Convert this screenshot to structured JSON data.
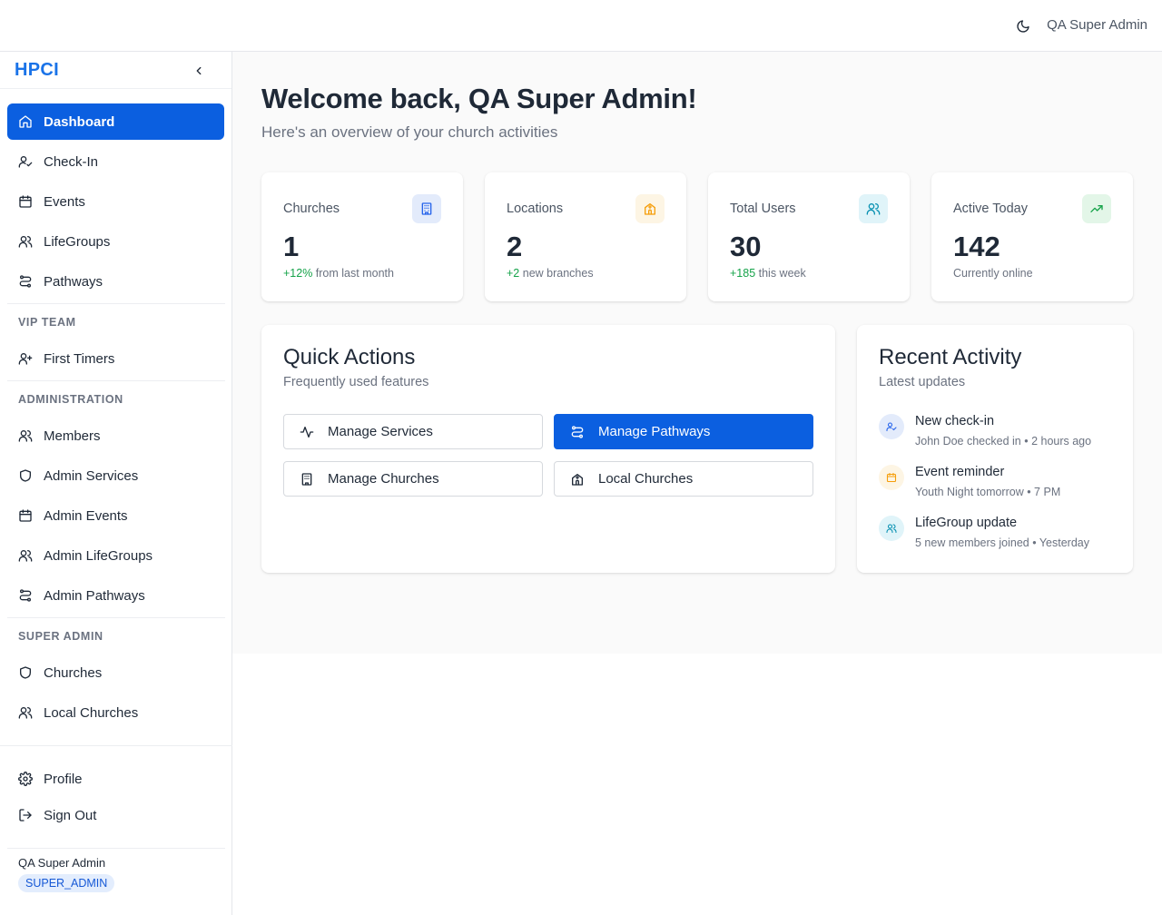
{
  "header": {
    "user_name": "QA Super Admin",
    "theme_icon": "moon-icon"
  },
  "sidebar": {
    "brand": "HPCI",
    "primary_items": [
      {
        "label": "Dashboard",
        "icon": "home-icon",
        "active": true
      },
      {
        "label": "Check-In",
        "icon": "user-check-icon"
      },
      {
        "label": "Events",
        "icon": "calendar-icon"
      },
      {
        "label": "LifeGroups",
        "icon": "users-icon"
      },
      {
        "label": "Pathways",
        "icon": "route-icon"
      }
    ],
    "sections": [
      {
        "label": "VIP TEAM",
        "items": [
          {
            "label": "First Timers",
            "icon": "user-plus-icon"
          }
        ]
      },
      {
        "label": "ADMINISTRATION",
        "items": [
          {
            "label": "Members",
            "icon": "users-icon"
          },
          {
            "label": "Admin Services",
            "icon": "shield-icon"
          },
          {
            "label": "Admin Events",
            "icon": "calendar-icon"
          },
          {
            "label": "Admin LifeGroups",
            "icon": "users-icon"
          },
          {
            "label": "Admin Pathways",
            "icon": "route-icon"
          }
        ]
      },
      {
        "label": "SUPER ADMIN",
        "items": [
          {
            "label": "Churches",
            "icon": "shield-icon"
          },
          {
            "label": "Local Churches",
            "icon": "users-icon"
          }
        ]
      }
    ],
    "footer_items": [
      {
        "label": "Profile",
        "icon": "gear-icon"
      },
      {
        "label": "Sign Out",
        "icon": "logout-icon"
      }
    ],
    "user": {
      "name": "QA Super Admin",
      "role": "SUPER_ADMIN"
    }
  },
  "main": {
    "welcome": "Welcome back, QA Super Admin!",
    "subtitle": "Here's an overview of your church activities",
    "stats": [
      {
        "label": "Churches",
        "value": "1",
        "delta": "+12%",
        "foot": " from last month",
        "icon": "building-icon",
        "accent": "#2563eb",
        "bg": "#e3ebfb"
      },
      {
        "label": "Locations",
        "value": "2",
        "delta": "+2",
        "foot": " new branches",
        "icon": "church-icon",
        "accent": "#f59e0b",
        "bg": "#fdf5e4"
      },
      {
        "label": "Total Users",
        "value": "30",
        "delta": "+185",
        "foot": " this week",
        "icon": "users-icon",
        "accent": "#0891b2",
        "bg": "#e0f4f9"
      },
      {
        "label": "Active Today",
        "value": "142",
        "delta": "",
        "foot": "Currently online",
        "icon": "trending-up-icon",
        "accent": "#16a34a",
        "bg": "#e3f6e8"
      }
    ],
    "quick_actions": {
      "title": "Quick Actions",
      "subtitle": "Frequently used features",
      "buttons": [
        {
          "label": "Manage Services",
          "icon": "activity-icon",
          "primary": false
        },
        {
          "label": "Manage Pathways",
          "icon": "route-icon",
          "primary": true
        },
        {
          "label": "Manage Churches",
          "icon": "building-icon",
          "primary": false
        },
        {
          "label": "Local Churches",
          "icon": "church-icon",
          "primary": false
        }
      ]
    },
    "recent_activity": {
      "title": "Recent Activity",
      "subtitle": "Latest updates",
      "items": [
        {
          "title": "New check-in",
          "desc": "John Doe checked in • 2 hours ago",
          "icon": "user-check-icon",
          "accent": "#2563eb",
          "bg": "#e3ebfb"
        },
        {
          "title": "Event reminder",
          "desc": "Youth Night tomorrow • 7 PM",
          "icon": "calendar-icon",
          "accent": "#f59e0b",
          "bg": "#fdf5e4"
        },
        {
          "title": "LifeGroup update",
          "desc": "5 new members joined • Yesterday",
          "icon": "users-icon",
          "accent": "#0891b2",
          "bg": "#e0f4f9"
        }
      ]
    }
  }
}
